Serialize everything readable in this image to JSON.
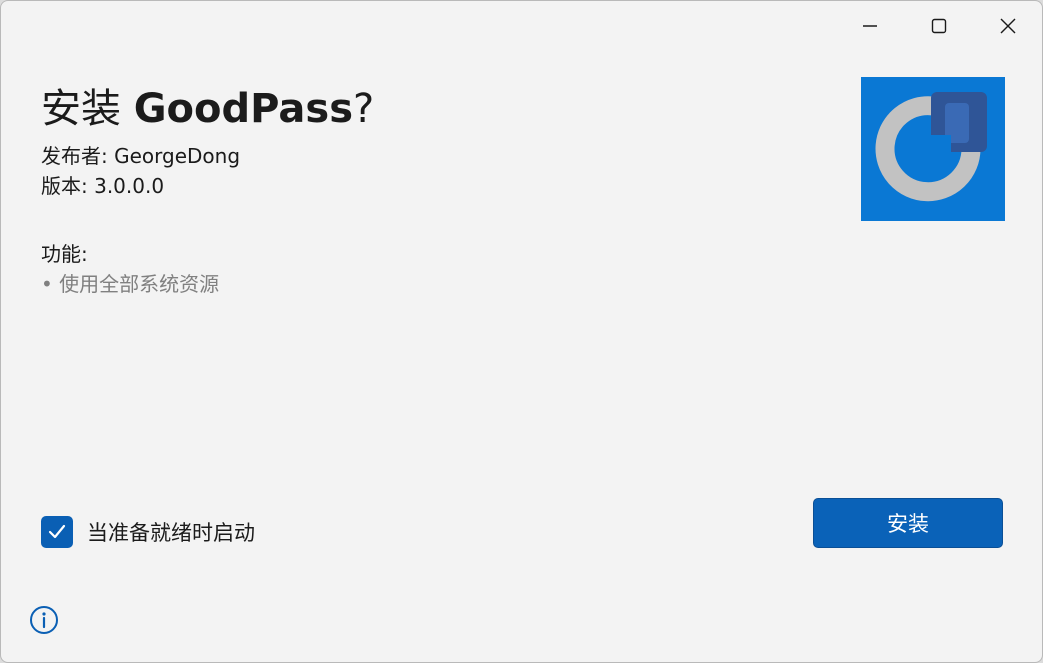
{
  "window": {
    "controls": {
      "minimize_icon": "minimize-icon",
      "maximize_icon": "maximize-icon",
      "close_icon": "close-icon"
    }
  },
  "header": {
    "title_prefix": "安装 ",
    "app_name": "GoodPass",
    "title_suffix": "?",
    "publisher": "发布者: GeorgeDong",
    "version": "版本: 3.0.0.0"
  },
  "capabilities": {
    "heading": "功能:",
    "items": [
      "• 使用全部系统资源"
    ]
  },
  "options": {
    "launch_when_ready_label": "当准备就绪时启动",
    "launch_when_ready_checked": true
  },
  "actions": {
    "install_label": "安装"
  },
  "colors": {
    "accent": "#0a62b8",
    "logo_background": "#0a78d4",
    "logo_ring": "#c2c2c2",
    "logo_dark_shape": "#2f5597"
  },
  "icons": {
    "logo": "goodpass-logo-icon",
    "checkmark": "checkmark-icon",
    "info": "info-icon"
  }
}
